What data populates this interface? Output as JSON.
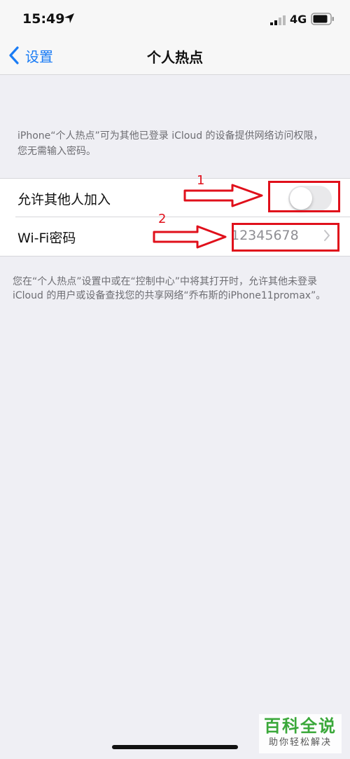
{
  "status_bar": {
    "time": "15:49",
    "network": "4G",
    "icons": [
      "location-arrow-icon",
      "signal-icon",
      "battery-icon"
    ]
  },
  "nav": {
    "back_label": "设置",
    "title": "个人热点"
  },
  "header_note": "iPhone“个人热点”可为其他已登录 iCloud 的设备提供网络访问权限，您无需输入密码。",
  "rows": {
    "allow_others": {
      "label": "允许其他人加入",
      "toggle_on": false
    },
    "wifi_password": {
      "label": "Wi-Fi密码",
      "value": "12345678"
    }
  },
  "footer_note": "您在“个人热点”设置中或在“控制中心”中将其打开时，允许其他未登录 iCloud 的用户或设备查找您的共享网络“乔布斯的iPhone11promax”。",
  "annotations": {
    "step_1": "1",
    "step_2": "2"
  },
  "watermark": {
    "main": "百科全说",
    "sub": "助你轻松解决"
  },
  "colors": {
    "accent": "#1a7cf5",
    "annotation": "#e0101b",
    "background": "#efeff4",
    "watermark": "#3aa83a"
  }
}
